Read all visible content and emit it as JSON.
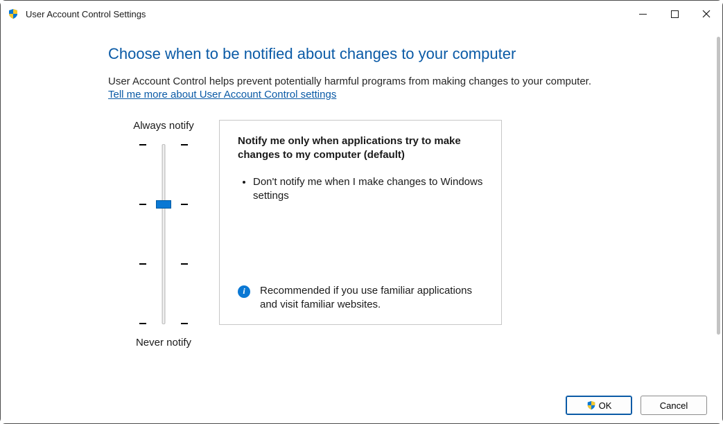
{
  "window": {
    "title": "User Account Control Settings"
  },
  "heading": "Choose when to be notified about changes to your computer",
  "description": "User Account Control helps prevent potentially harmful programs from making changes to your computer.",
  "help_link": "Tell me more about User Account Control settings",
  "slider": {
    "top_label": "Always notify",
    "bottom_label": "Never notify",
    "levels": 4,
    "selected_index": 1
  },
  "info": {
    "title": "Notify me only when applications try to make changes to my computer (default)",
    "bullet": "Don't notify me when I make changes to Windows settings",
    "recommendation": "Recommended if you use familiar applications and visit familiar websites."
  },
  "buttons": {
    "ok": "OK",
    "cancel": "Cancel"
  }
}
